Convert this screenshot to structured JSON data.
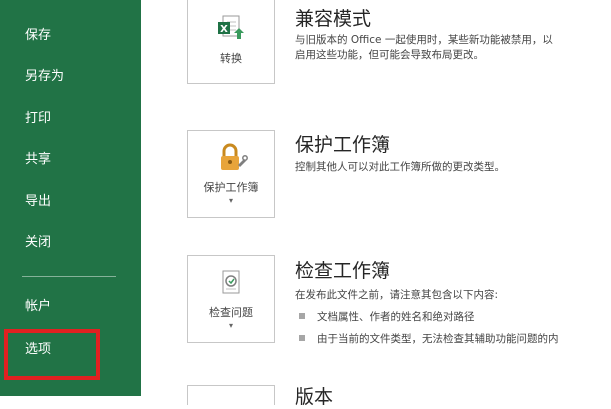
{
  "sidebar": {
    "items": [
      {
        "label": "保存"
      },
      {
        "label": "另存为"
      },
      {
        "label": "打印"
      },
      {
        "label": "共享"
      },
      {
        "label": "导出"
      },
      {
        "label": "关闭"
      },
      {
        "label": "帐户"
      },
      {
        "label": "选项"
      }
    ]
  },
  "sections": {
    "compat": {
      "title": "兼容模式",
      "desc_line1": "与旧版本的 Office 一起使用时，某些新功能被禁用，以",
      "desc_line2": "启用这些功能，但可能会导致布局更改。",
      "tile_label": "转换"
    },
    "protect": {
      "title": "保护工作簿",
      "desc": "控制其他人可以对此工作簿所做的更改类型。",
      "tile_label": "保护工作簿",
      "tile_caret": "▾"
    },
    "inspect": {
      "title": "检查工作簿",
      "desc": "在发布此文件之前，请注意其包含以下内容:",
      "bullets": [
        "文档属性、作者的姓名和绝对路径",
        "由于当前的文件类型，无法检查其辅助功能问题的内"
      ],
      "tile_label": "检查问题",
      "tile_caret": "▾"
    },
    "version": {
      "title": "版本"
    }
  },
  "colors": {
    "sidebar": "#217346",
    "highlight_box": "#e02121"
  },
  "icons": {
    "compat": "excel-convert-icon",
    "protect": "lock-key-icon",
    "inspect": "inspect-document-icon"
  }
}
